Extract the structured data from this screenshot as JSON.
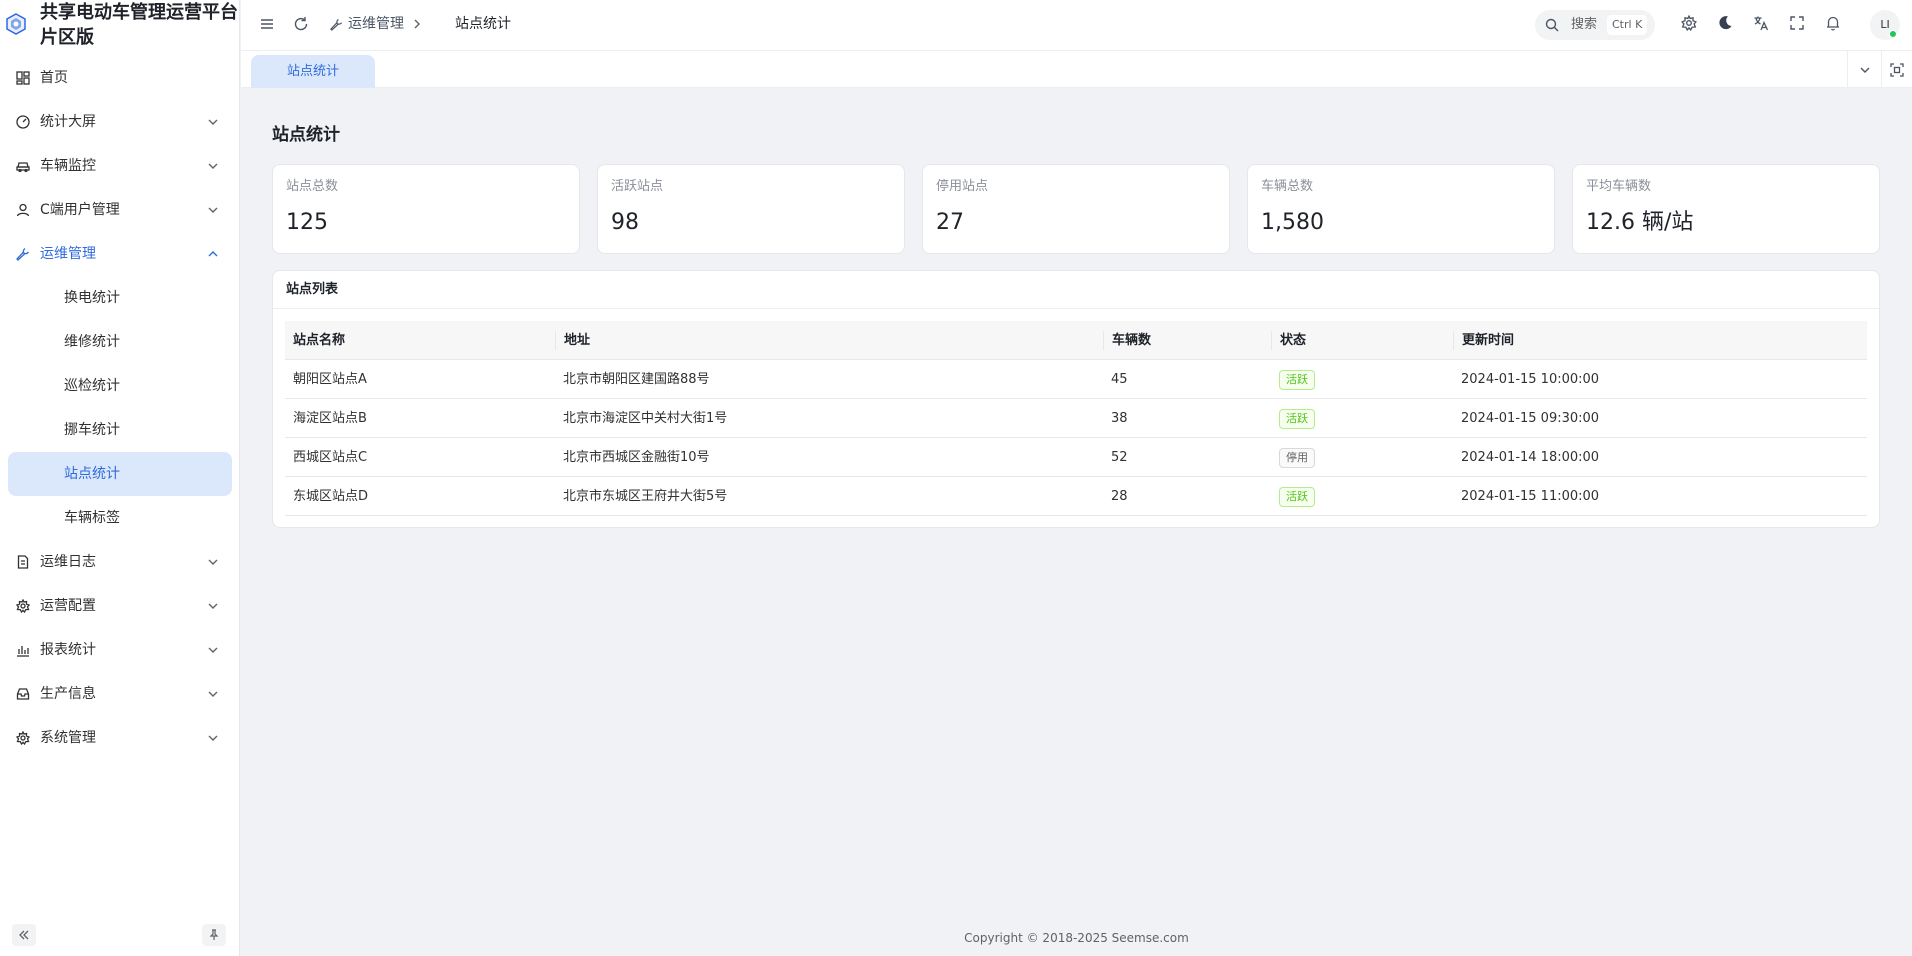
{
  "app": {
    "title": "共享电动车管理运营平台片区版"
  },
  "sidebar": {
    "items": [
      {
        "label": "首页",
        "icon": "dashboard-icon"
      },
      {
        "label": "统计大屏",
        "icon": "gauge-icon"
      },
      {
        "label": "车辆监控",
        "icon": "car-icon"
      },
      {
        "label": "C端用户管理",
        "icon": "user-icon"
      },
      {
        "label": "运维管理",
        "icon": "wrench-icon"
      },
      {
        "label": "运维日志",
        "icon": "document-icon"
      },
      {
        "label": "运营配置",
        "icon": "gear-icon"
      },
      {
        "label": "报表统计",
        "icon": "bar-chart-icon"
      },
      {
        "label": "生产信息",
        "icon": "inbox-icon"
      },
      {
        "label": "系统管理",
        "icon": "gear-icon"
      }
    ],
    "sub_items": [
      "换电统计",
      "维修统计",
      "巡检统计",
      "挪车统计",
      "站点统计",
      "车辆标签"
    ],
    "active_sub": "站点统计"
  },
  "header": {
    "breadcrumb": [
      "运维管理",
      "站点统计"
    ],
    "search_placeholder": "搜索",
    "search_shortcut": "Ctrl K",
    "avatar": "LI"
  },
  "tabs": [
    {
      "label": "站点统计",
      "active": true
    }
  ],
  "page": {
    "title": "站点统计"
  },
  "stats": [
    {
      "label": "站点总数",
      "value": "125"
    },
    {
      "label": "活跃站点",
      "value": "98"
    },
    {
      "label": "停用站点",
      "value": "27"
    },
    {
      "label": "车辆总数",
      "value": "1,580"
    },
    {
      "label": "平均车辆数",
      "value": "12.6 辆/站"
    }
  ],
  "table": {
    "title": "站点列表",
    "columns": [
      "站点名称",
      "地址",
      "车辆数",
      "状态",
      "更新时间"
    ],
    "rows": [
      {
        "name": "朝阳区站点A",
        "address": "北京市朝阳区建国路88号",
        "vehicles": "45",
        "status": "活跃",
        "updated": "2024-01-15 10:00:00"
      },
      {
        "name": "海淀区站点B",
        "address": "北京市海淀区中关村大街1号",
        "vehicles": "38",
        "status": "活跃",
        "updated": "2024-01-15 09:30:00"
      },
      {
        "name": "西城区站点C",
        "address": "北京市西城区金融街10号",
        "vehicles": "52",
        "status": "停用",
        "updated": "2024-01-14 18:00:00"
      },
      {
        "name": "东城区站点D",
        "address": "北京市东城区王府井大街5号",
        "vehicles": "28",
        "status": "活跃",
        "updated": "2024-01-15 11:00:00"
      }
    ]
  },
  "footer": {
    "copyright": "Copyright © 2018-2025 Seemse.com"
  },
  "colors": {
    "primary": "#2f6bdc",
    "active_bg": "#dbe7fb",
    "status_active": "#52c41a",
    "status_disabled": "#606266"
  }
}
